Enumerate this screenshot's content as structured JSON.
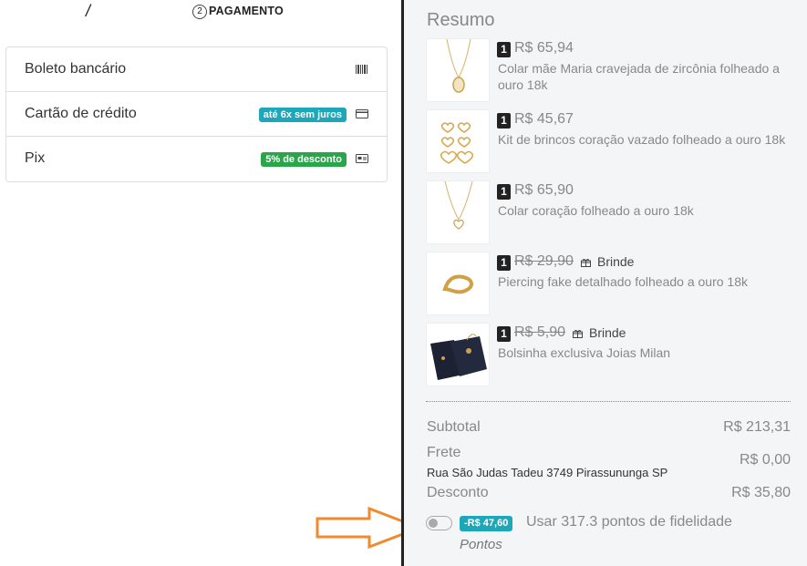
{
  "steps": {
    "current_number": "2",
    "current_label": "PAGAMENTO",
    "separator": "/"
  },
  "payment_methods": [
    {
      "label": "Boleto bancário",
      "badge": "",
      "icon": "barcode-icon"
    },
    {
      "label": "Cartão de crédito",
      "badge": "até 6x sem juros",
      "icon": "credit-card-icon"
    },
    {
      "label": "Pix",
      "badge": "5% de desconto",
      "icon": "pix-card-icon"
    }
  ],
  "summary": {
    "title": "Resumo",
    "items": [
      {
        "qty": "1",
        "price": "R$ 65,94",
        "strike": false,
        "gift": "",
        "name": "Colar mãe Maria cravejada de zircônia folheado a ouro 18k"
      },
      {
        "qty": "1",
        "price": "R$ 45,67",
        "strike": false,
        "gift": "",
        "name": "Kit de brincos coração vazado folheado a ouro 18k"
      },
      {
        "qty": "1",
        "price": "R$ 65,90",
        "strike": false,
        "gift": "",
        "name": "Colar coração folheado a ouro 18k"
      },
      {
        "qty": "1",
        "price": "R$ 29,90",
        "strike": true,
        "gift": "Brinde",
        "name": "Piercing fake detalhado folheado a ouro 18k"
      },
      {
        "qty": "1",
        "price": "R$ 5,90",
        "strike": true,
        "gift": "Brinde",
        "name": "Bolsinha exclusiva Joias Milan"
      }
    ],
    "subtotal_label": "Subtotal",
    "subtotal_value": "R$ 213,31",
    "shipping_label": "Frete",
    "shipping_value": "R$ 0,00",
    "shipping_address": "Rua São Judas Tadeu 3749 Pirassununga SP",
    "discount_label": "Desconto",
    "discount_value": "R$ 35,80"
  },
  "loyalty": {
    "toggle_on": false,
    "badge": "-R$ 47,60",
    "label": "Usar 317.3 pontos de fidelidade",
    "sublabel": "Pontos"
  },
  "colors": {
    "accent_blue": "#1ea7b8",
    "accent_green": "#2aa54a",
    "arrow_orange": "#f08a2c",
    "summary_bg": "#f4f5f6"
  }
}
